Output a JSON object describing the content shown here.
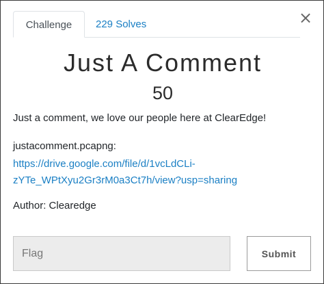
{
  "tabs": {
    "challenge_label": "Challenge",
    "solves_label": "229 Solves"
  },
  "close_glyph": "×",
  "challenge": {
    "title": "Just A Comment",
    "value": "50",
    "description": "Just a comment, we love our people here at ClearEdge!",
    "file_label": "justacomment.pcapng:",
    "link_line1": "https://drive.google.com/file/d/1vcLdCLi-",
    "link_line2": "zYTe_WPtXyu2Gr3rM0a3Ct7h/view?usp=sharing",
    "author": "Author: Clearedge"
  },
  "form": {
    "flag_placeholder": "Flag",
    "flag_value": "",
    "submit_label": "Submit"
  },
  "colors": {
    "link": "#1a7fc4",
    "input_bg": "#ececec",
    "border": "#dee2e6"
  },
  "icons": {
    "close": "close-icon"
  }
}
